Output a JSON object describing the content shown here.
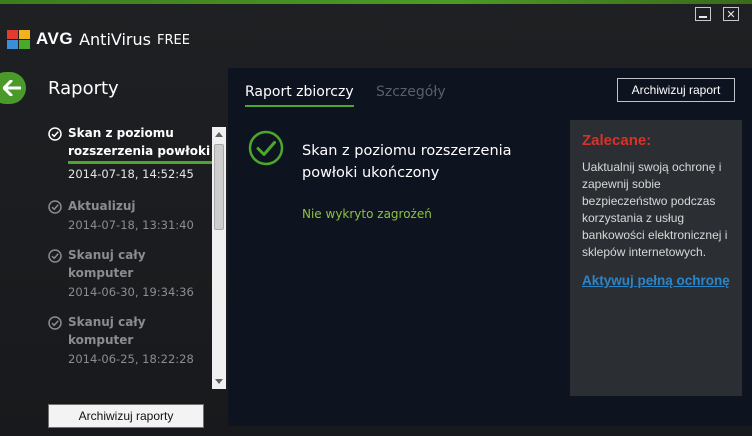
{
  "header": {
    "brand": "AVG",
    "product": "AntiVirus",
    "edition": "FREE",
    "colors": {
      "accent": "#4aa82a",
      "alert": "#d4342a",
      "link": "#2a86c9"
    }
  },
  "window_controls": {
    "minimize_icon": "minimize-icon",
    "close_icon": "close-icon",
    "close_glyph": "✕"
  },
  "sidebar": {
    "title": "Raporty",
    "reports": [
      {
        "title": "Skan z poziomu rozszerzenia powłoki",
        "date": "2014-07-18, 14:52:45",
        "active": true
      },
      {
        "title": "Aktualizuj",
        "date": "2014-07-18, 13:31:40",
        "active": false
      },
      {
        "title": "Skanuj cały komputer",
        "date": "2014-06-30, 19:34:36",
        "active": false
      },
      {
        "title": "Skanuj cały komputer",
        "date": "2014-06-25, 18:22:28",
        "active": false
      }
    ],
    "archive_all_label": "Archiwizuj raporty"
  },
  "main": {
    "tabs": [
      {
        "label": "Raport zbiorczy",
        "active": true
      },
      {
        "label": "Szczegóły",
        "active": false
      }
    ],
    "archive_label": "Archiwizuj raport",
    "result_title": "Skan z poziomu rozszerzenia powłoki ukończony",
    "result_status": "Nie wykryto zagrożeń",
    "recommend": {
      "title": "Zalecane:",
      "text": "Uaktualnij swoją ochronę i zapewnij sobie bezpieczeństwo podczas korzystania z usług bankowości elektronicznej i sklepów internetowych.",
      "link": "Aktywuj pełną ochronę"
    }
  }
}
